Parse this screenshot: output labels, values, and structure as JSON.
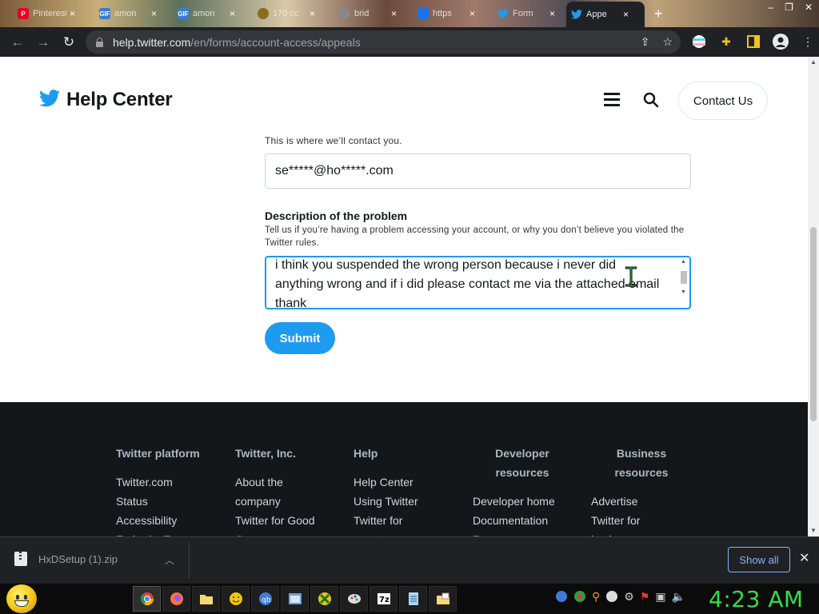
{
  "browser": {
    "tabs": [
      {
        "title": "Pinterest",
        "favicon": "pinterest-icon",
        "color": "#e60023"
      },
      {
        "title": "amon",
        "favicon": "gif-icon",
        "color": "#3a7bd5"
      },
      {
        "title": "amon",
        "favicon": "gif-icon",
        "color": "#3a7bd5"
      },
      {
        "title": "170 cc",
        "favicon": "coin-icon",
        "color": "#8a6d1e"
      },
      {
        "title": "brid",
        "favicon": "globe-icon",
        "color": "#888888"
      },
      {
        "title": "https",
        "favicon": "bookmark-icon",
        "color": "#1a73e8"
      },
      {
        "title": "Form",
        "favicon": "twitter-icon",
        "color": "#1d9bf0"
      },
      {
        "title": "Appe",
        "favicon": "twitter-icon",
        "color": "#1d9bf0"
      }
    ],
    "active_tab_index": 7,
    "url_host": "help.twitter.com",
    "url_path": "/en/forms/account-access/appeals"
  },
  "header": {
    "title": "Help Center",
    "contact_label": "Contact Us"
  },
  "form": {
    "email_hint": "This is where we’ll contact you.",
    "email_value": "se*****@ho*****.com",
    "description_label": "Description of the problem",
    "description_sub": "Tell us if you’re having a problem accessing your account, or why you don’t believe you violated the Twitter rules.",
    "description_value": "i think you suspended the wrong person because i never did anything wrong and if i did please contact me via the attached email thank",
    "submit_label": "Submit"
  },
  "footer": {
    "columns": [
      {
        "heading": "Twitter platform",
        "links": [
          "Twitter.com",
          "Status",
          "Accessibility",
          "Embed a Tweet"
        ]
      },
      {
        "heading": "Twitter, Inc.",
        "links": [
          "About the",
          "company",
          "Twitter for Good",
          "Company news"
        ]
      },
      {
        "heading": "Help",
        "links": [
          "Help Center",
          "Using Twitter",
          "Twitter for",
          "creators"
        ]
      },
      {
        "heading": "Developer resources",
        "links": [
          "Developer home",
          "Documentation",
          "Forums"
        ]
      },
      {
        "heading": "Business resources",
        "links": [
          "Advertise",
          "Twitter for",
          "business"
        ]
      }
    ]
  },
  "downloads": {
    "file_name": "HxDSetup (1).zip",
    "show_all_label": "Show all"
  },
  "taskbar": {
    "clock": "4:23 AM",
    "apps": [
      "chrome-icon",
      "firefox-icon",
      "folder-icon",
      "emoji-icon",
      "qbittorrent-icon",
      "window-icon",
      "xbox-icon",
      "paint-icon",
      "7zip-icon",
      "notepad-icon",
      "files-icon"
    ]
  },
  "colors": {
    "twitter_blue": "#1d9bf0",
    "footer_bg": "#14171a",
    "clock_green": "#2fe04a"
  }
}
